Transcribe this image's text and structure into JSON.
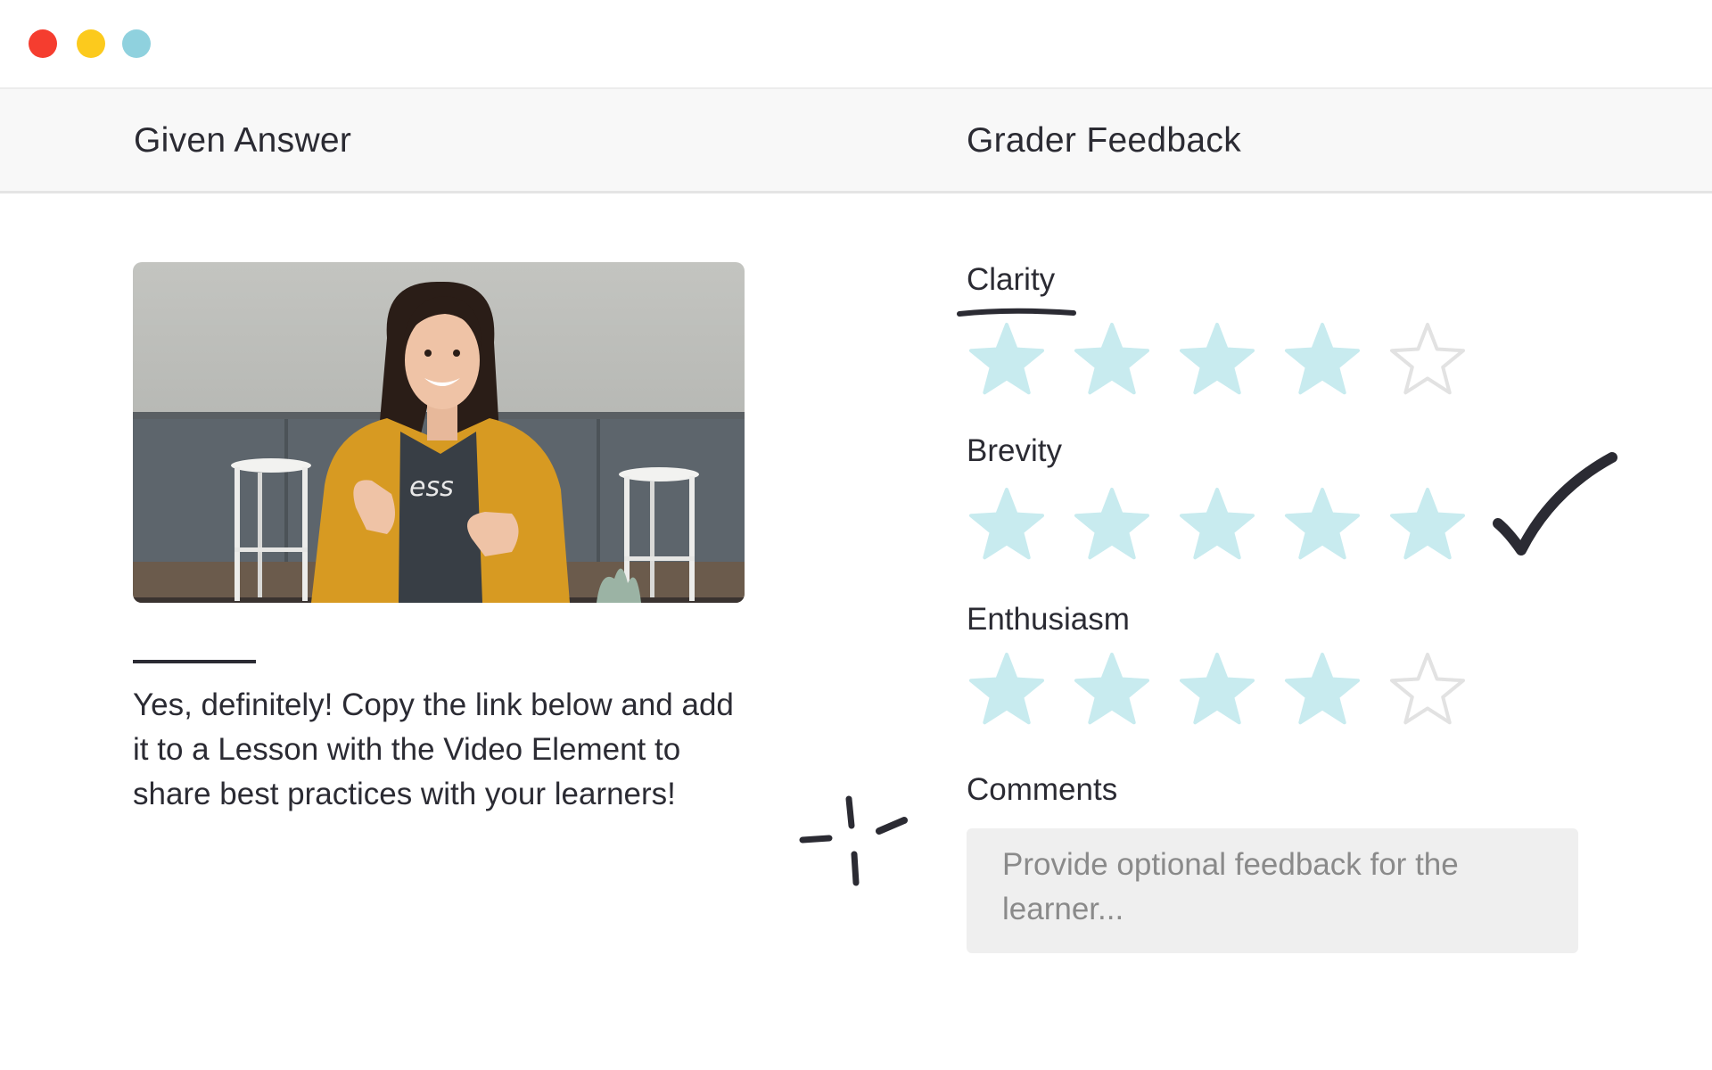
{
  "window": {
    "controls": [
      "close",
      "minimize",
      "maximize"
    ]
  },
  "header": {
    "given_answer": "Given Answer",
    "grader_feedback": "Grader Feedback"
  },
  "answer": {
    "video_thumbnail": "person-presenting-photo",
    "text": "Yes, definitely! Copy the link below and add it to a Lesson with the Video Element to share best practices with your learners!"
  },
  "feedback": {
    "criteria": [
      {
        "label": "Clarity",
        "rating": 4,
        "max": 5
      },
      {
        "label": "Brevity",
        "rating": 5,
        "max": 5
      },
      {
        "label": "Enthusiasm",
        "rating": 4,
        "max": 5
      }
    ],
    "comments_label": "Comments",
    "comments_placeholder": "Provide optional feedback for the learner..."
  },
  "colors": {
    "star_filled": "#c8ebef",
    "star_empty_stroke": "#e2e2e2",
    "close": "#f53d2f",
    "minimize": "#fcca1d",
    "maximize": "#8fd1de",
    "ink": "#2b2b33"
  }
}
